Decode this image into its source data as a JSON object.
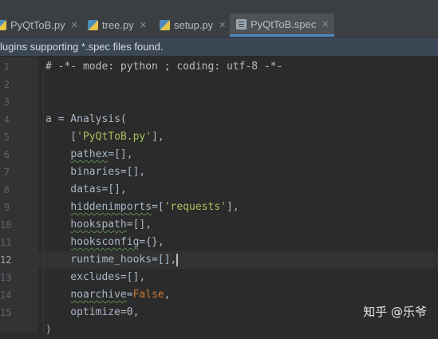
{
  "tabs": [
    {
      "label": "PyQtToB.py",
      "icon": "python-file-icon",
      "active": false
    },
    {
      "label": "tree.py",
      "icon": "python-file-icon",
      "active": false
    },
    {
      "label": "setup.py",
      "icon": "python-file-icon",
      "active": false
    },
    {
      "label": "PyQtToB.spec",
      "icon": "spec-file-icon",
      "active": true
    }
  ],
  "banner": {
    "text": "lugins supporting *.spec files found."
  },
  "editor": {
    "line_numbers": [
      "1",
      "2",
      "3",
      "4",
      "5",
      "6",
      "7",
      "8",
      "9",
      "10",
      "11",
      "12",
      "13",
      "14",
      "15"
    ],
    "current_line": 12,
    "lines": [
      "# -*- mode: python ; coding: utf-8 -*-",
      "",
      "",
      "a = Analysis(",
      "    ['PyQtToB.py'],",
      "    pathex=[],",
      "    binaries=[],",
      "    datas=[],",
      "    hiddenimports=['requests'],",
      "    hookspath=[],",
      "    hooksconfig={},",
      "    runtime_hooks=[],",
      "    excludes=[],",
      "    noarchive=False,",
      "    optimize=0,",
      ")"
    ]
  },
  "watermark": "知乎 @乐爷",
  "colors": {
    "accent": "#4a88c7",
    "background": "#2b2b2b",
    "string": "#a5c25c",
    "banner": "#3b4754"
  }
}
